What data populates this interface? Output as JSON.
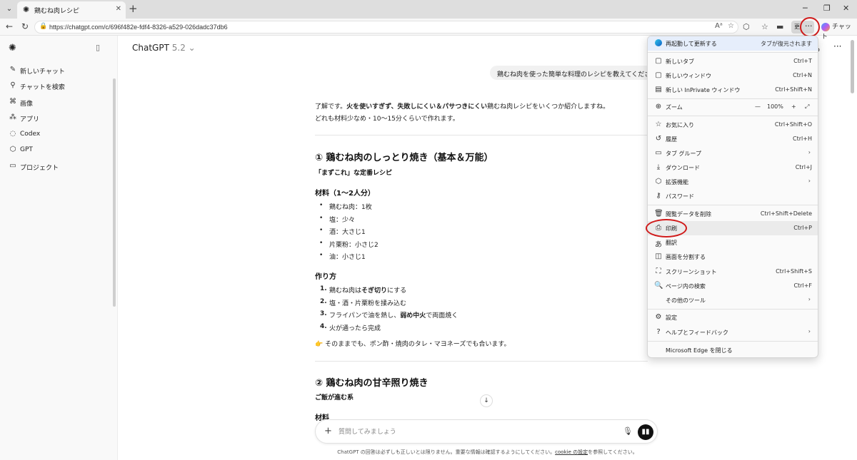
{
  "browser": {
    "tab_title": "鶏むね肉レシピ",
    "url": "https://chatgpt.com/c/696f482e-fdf4-8326-a529-026dadc37db6",
    "more_label": "更",
    "copilot_label": "チャット"
  },
  "sidebar": {
    "items": [
      {
        "label": "新しいチャット",
        "icon": "edit-icon"
      },
      {
        "label": "チャットを検索",
        "icon": "search-icon"
      },
      {
        "label": "画像",
        "icon": "image-icon"
      },
      {
        "label": "アプリ",
        "icon": "apps-icon"
      },
      {
        "label": "Codex",
        "icon": "codex-icon"
      },
      {
        "label": "GPT",
        "icon": "gpt-icon"
      },
      {
        "label": "プロジェクト",
        "icon": "folder-icon"
      }
    ]
  },
  "header": {
    "model": "ChatGPT",
    "version": "5.2 ⌄",
    "right_text": "る"
  },
  "chat": {
    "user_message": "鶏むね肉を使った簡単な料理のレシピを教えてください",
    "intro_1_pre": "了解です。",
    "intro_1_bold": "火を使いすぎず、失敗しにくい＆パサつきにくい",
    "intro_1_post": "鶏むね肉レシピをいくつか紹介しますね。",
    "intro_2": "どれも材料少なめ・10〜15分くらいで作れます。",
    "recipe1": {
      "title": "① 鶏むね肉のしっとり焼き（基本＆万能）",
      "tagline": "「まずこれ」な定番レシピ",
      "ingredients_title": "材料（1〜2人分）",
      "ingredients": [
        "鶏むね肉：1枚",
        "塩：少々",
        "酒：大さじ1",
        "片栗粉：小さじ2",
        "油：小さじ1"
      ],
      "steps_title": "作り方",
      "step1_pre": "鶏むね肉は",
      "step1_bold": "そぎ切り",
      "step1_post": "にする",
      "step2": "塩・酒・片栗粉を揉み込む",
      "step3_pre": "フライパンで油を熱し、",
      "step3_bold": "弱め中火",
      "step3_post": "で両面焼く",
      "step4": "火が通ったら完成",
      "tip": "👉 そのままでも、ポン酢・焼肉のタレ・マヨネーズでも合います。"
    },
    "recipe2": {
      "title": "② 鶏むね肉の甘辛照り焼き",
      "tagline": "ご飯が進む系",
      "ingredients_title": "材料"
    }
  },
  "composer": {
    "placeholder": "質問してみましょう"
  },
  "disclaimer": {
    "pre": "ChatGPT の回答は必ずしも正しいとは限りません。重要な情報は確認するようにしてください。",
    "link": "cookie の設定",
    "post": "を参照してください。"
  },
  "menu": {
    "restart": {
      "label": "再起動して更新する",
      "note": "タブが復元されます"
    },
    "new_tab": {
      "label": "新しいタブ",
      "shortcut": "Ctrl+T"
    },
    "new_window": {
      "label": "新しいウィンドウ",
      "shortcut": "Ctrl+N"
    },
    "inprivate": {
      "label": "新しい InPrivate ウィンドウ",
      "shortcut": "Ctrl+Shift+N"
    },
    "zoom": {
      "label": "ズーム",
      "value": "100%"
    },
    "favorites": {
      "label": "お気に入り",
      "shortcut": "Ctrl+Shift+O"
    },
    "history": {
      "label": "履歴",
      "shortcut": "Ctrl+H"
    },
    "tab_groups": {
      "label": "タブ グループ"
    },
    "downloads": {
      "label": "ダウンロード",
      "shortcut": "Ctrl+J"
    },
    "extensions": {
      "label": "拡張機能"
    },
    "passwords": {
      "label": "パスワード"
    },
    "clear_data": {
      "label": "閲覧データを削除",
      "shortcut": "Ctrl+Shift+Delete"
    },
    "print": {
      "label": "印刷",
      "shortcut": "Ctrl+P"
    },
    "translate": {
      "label": "翻訳"
    },
    "split": {
      "label": "画面を分割する"
    },
    "screenshot": {
      "label": "スクリーンショット",
      "shortcut": "Ctrl+Shift+S"
    },
    "find": {
      "label": "ページ内の検索",
      "shortcut": "Ctrl+F"
    },
    "more_tools": {
      "label": "その他のツール"
    },
    "settings": {
      "label": "設定"
    },
    "help": {
      "label": "ヘルプとフィードバック"
    },
    "close": {
      "label": "Microsoft Edge を閉じる"
    }
  },
  "colors": {
    "annotation_ring": "#d01a1a",
    "menu_highlight": "#ebebeb"
  }
}
